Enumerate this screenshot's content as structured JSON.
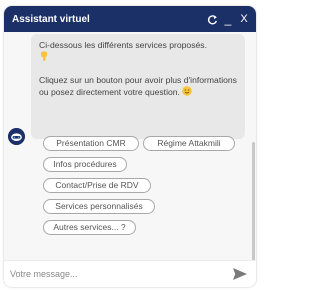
{
  "header": {
    "title": "Assistant virtuel",
    "icons": {
      "refresh": "refresh-icon",
      "minimize": "minimize-icon",
      "close": "close-icon"
    },
    "minimize_glyph": "_",
    "close_glyph": "X"
  },
  "message": {
    "line1": "Ci-dessous les différents services proposés.",
    "line2": "Cliquez sur un bouton pour avoir plus d'informations ou posez directement votre question.",
    "emoji1": "hand-pointing-down-icon",
    "emoji2": "smiling-face-icon"
  },
  "quick_replies": [
    "Présentation CMR",
    "Régime Attakmili",
    "Infos procédures",
    "Contact/Prise de RDV",
    "Services personnalisés",
    "Autres services... ?"
  ],
  "input": {
    "placeholder": "Votre message...",
    "send_icon": "send-icon"
  },
  "colors": {
    "header": "#1b3067",
    "bubble": "#e8e8e8",
    "chip_border": "#a8a8a8",
    "panel_bg": "#f7f7f7"
  }
}
